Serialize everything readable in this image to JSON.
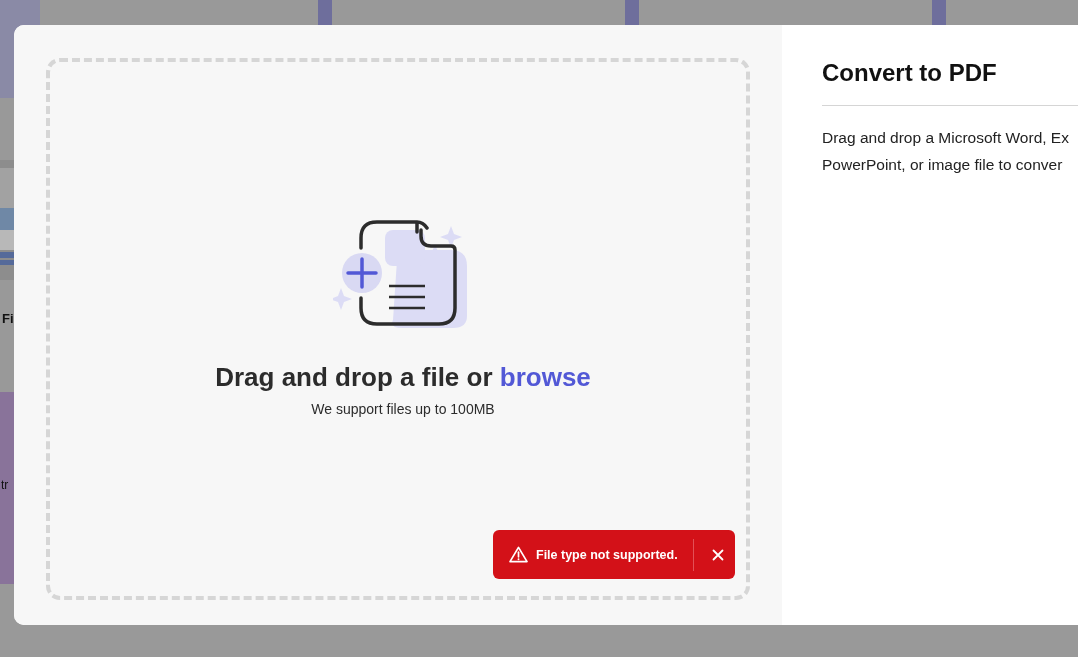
{
  "background": {
    "side_label": "Fi",
    "banner_text": "tr"
  },
  "dialog": {
    "title": "Convert to PDF",
    "description_lines": [
      "Drag and drop a Microsoft Word, Ex",
      "PowerPoint, or image file to conver"
    ],
    "dropzone": {
      "heading": "Drag and drop a file or",
      "link": "browse",
      "note": "We support files up to 100MB"
    },
    "toast": {
      "message": "File type not supported."
    }
  }
}
